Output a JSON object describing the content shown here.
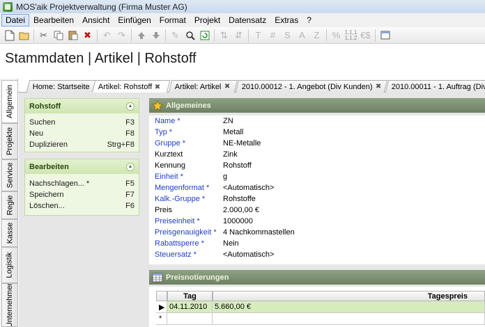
{
  "window": {
    "title": "MOS'aik Projektverwaltung (Firma Muster AG)"
  },
  "menu": [
    "Datei",
    "Bearbeiten",
    "Ansicht",
    "Einfügen",
    "Format",
    "Projekt",
    "Datensatz",
    "Extras",
    "?"
  ],
  "toolbar": {
    "letters": [
      "T",
      "#",
      "S",
      "A",
      "Z"
    ],
    "percent": "%",
    "num_top": "1,1,1",
    "num_bottom": "1,1,2",
    "currency": "€$"
  },
  "page_title": "Stammdaten | Artikel | Rohstoff",
  "side_tabs": [
    "Allgemein",
    "Projekte",
    "Service",
    "Regie",
    "Kasse",
    "Logistik",
    "Unternehmer"
  ],
  "doc_tabs": [
    {
      "label": "Home: Startseite",
      "closable": false
    },
    {
      "label": "Artikel: Rohstoff",
      "closable": true
    },
    {
      "label": "Artikel: Artikel",
      "closable": true
    },
    {
      "label": "2010.00012 - 1. Angebot (Div Kunden)",
      "closable": true
    },
    {
      "label": "2010.00011 - 1. Auftrag (Div",
      "closable": false
    }
  ],
  "tab_close_glyph": "✖",
  "panels": [
    {
      "title": "Rohstoff",
      "items": [
        {
          "label": "Suchen",
          "key": "F3"
        },
        {
          "label": "Neu",
          "key": "F8"
        },
        {
          "label": "Duplizieren",
          "key": "Strg+F8"
        }
      ]
    },
    {
      "title": "Bearbeiten",
      "items": [
        {
          "label": "Nachschlagen... *",
          "key": "F5"
        },
        {
          "label": "Speichern",
          "key": "F7"
        },
        {
          "label": "Löschen...",
          "key": "F6"
        }
      ]
    }
  ],
  "general": {
    "title": "Allgemeines",
    "fields": [
      {
        "label": "Name *",
        "value": "ZN",
        "link": true
      },
      {
        "label": "Typ *",
        "value": "Metall",
        "link": true
      },
      {
        "label": "Gruppe *",
        "value": "NE-Metalle",
        "link": true
      },
      {
        "label": "Kurztext",
        "value": "Zink",
        "link": false
      },
      {
        "label": "Kennung",
        "value": "Rohstoff",
        "link": false
      },
      {
        "label": "Einheit *",
        "value": "g",
        "link": true
      },
      {
        "label": "Mengenformat *",
        "value": "<Automatisch>",
        "link": true
      },
      {
        "label": "Kalk.-Gruppe *",
        "value": "Rohstoffe",
        "link": true
      },
      {
        "label": "Preis",
        "value": "2.000,00 €",
        "link": false
      },
      {
        "label": "Preiseinheit *",
        "value": "1000000",
        "link": true
      },
      {
        "label": "Preisgenauigkeit *",
        "value": "4 Nachkommastellen",
        "link": true
      },
      {
        "label": "Rabattsperre *",
        "value": "Nein",
        "link": true
      },
      {
        "label": "Steuersatz *",
        "value": "<Automatisch>",
        "link": true
      }
    ]
  },
  "prices": {
    "title": "Preisnotierungen",
    "columns": [
      "Tag",
      "Tagespreis"
    ],
    "rows": [
      {
        "tag": "04.11.2010",
        "preis": "5.660,00 €"
      }
    ],
    "new_row_marker": "*",
    "current_row_marker": "▶"
  },
  "colors": {
    "link_label": "#1f3ec1",
    "panel_bg": "#eef7e2",
    "section_head": "#7b8d70",
    "selected_row": "#d6ecbd"
  }
}
